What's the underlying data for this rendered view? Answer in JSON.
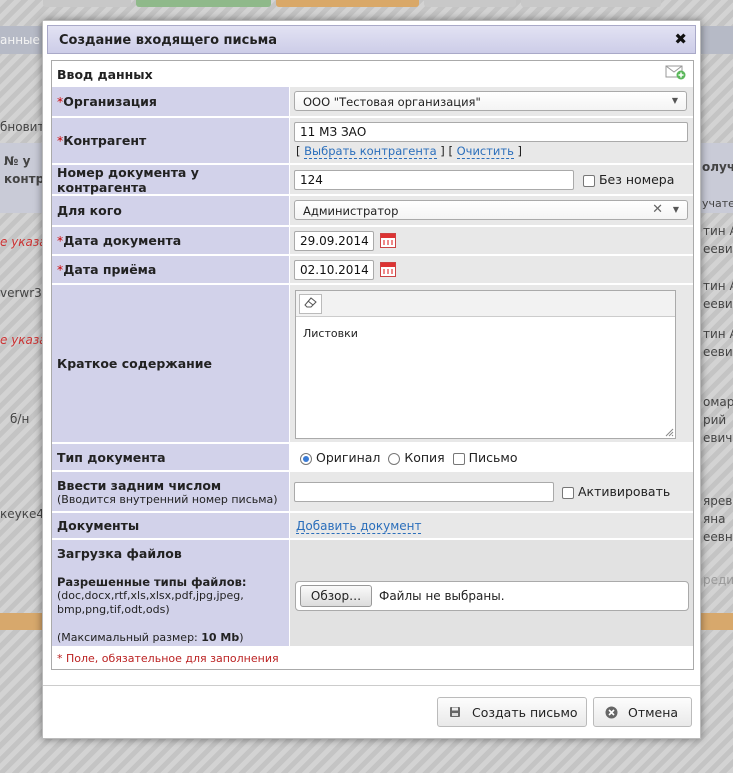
{
  "background": {
    "header_text": "анные м",
    "col1_header": "№ у контрагента",
    "col2_header": "олуч",
    "col2_sub": "учате",
    "left_items": [
      "бновит",
      "е указа",
      "verwr3",
      "е указа",
      "б/н",
      "кеуке4"
    ],
    "right_items": [
      "тин А\nеевич",
      "тин А\nеевич",
      "тин А\nеевич",
      "омаре\nрий\nевич",
      "ярева\nяна\nеевн"
    ],
    "right_link": "реди"
  },
  "dialog": {
    "title": "Создание входящего письма",
    "section_title": "Ввод данных",
    "required_mark": "*",
    "fields": {
      "organization": {
        "label": "Организация",
        "value": "ООО \"Тестовая организация\""
      },
      "counterparty": {
        "label": "Контрагент",
        "value": "11 МЗ ЗАО",
        "select_link": "Выбрать контрагента",
        "clear_link": "Очистить"
      },
      "doc_number": {
        "label": "Номер документа у контрагента",
        "value": "124",
        "no_number_label": "Без номера"
      },
      "for_whom": {
        "label": "Для кого",
        "value": "Администратор"
      },
      "doc_date": {
        "label": "Дата документа",
        "value": "29.09.2014"
      },
      "receive_date": {
        "label": "Дата приёма",
        "value": "02.10.2014"
      },
      "summary": {
        "label": "Краткое содержание",
        "value": "Листовки"
      },
      "doc_type": {
        "label": "Тип документа",
        "options": [
          "Оригинал",
          "Копия"
        ],
        "selected": "Оригинал",
        "letter_label": "Письмо"
      },
      "backdate": {
        "label": "Ввести задним числом",
        "sublabel": "(Вводится внутренний номер письма)",
        "value": "",
        "activate_label": "Активировать"
      },
      "documents": {
        "label": "Документы",
        "add_link": "Добавить документ"
      },
      "upload": {
        "label": "Загрузка файлов",
        "types_label": "Разрешенные типы файлов:",
        "types_list": "(doc,docx,rtf,xls,xlsx,pdf,jpg,jpeg,\nbmp,png,tif,odt,ods)",
        "max_size_prefix": "(Максимальный размер: ",
        "max_size_value": "10 Mb",
        "max_size_suffix": ")",
        "browse_label": "Обзор…",
        "no_files_text": "Файлы не выбраны."
      }
    },
    "required_note": "* Поле, обязательное для заполнения",
    "create_button": "Создать письмо",
    "cancel_button": "Отмена"
  },
  "colors": {
    "label_bg": "#d2d2ea",
    "value_bg": "#e8e8e8",
    "required": "#cc0000",
    "link": "#2a6ebb"
  },
  "icons": [
    "close-icon",
    "add-mail-icon",
    "calendar-icon",
    "eraser-icon",
    "save-icon",
    "cancel-icon",
    "chevron-down-icon",
    "clear-icon"
  ]
}
